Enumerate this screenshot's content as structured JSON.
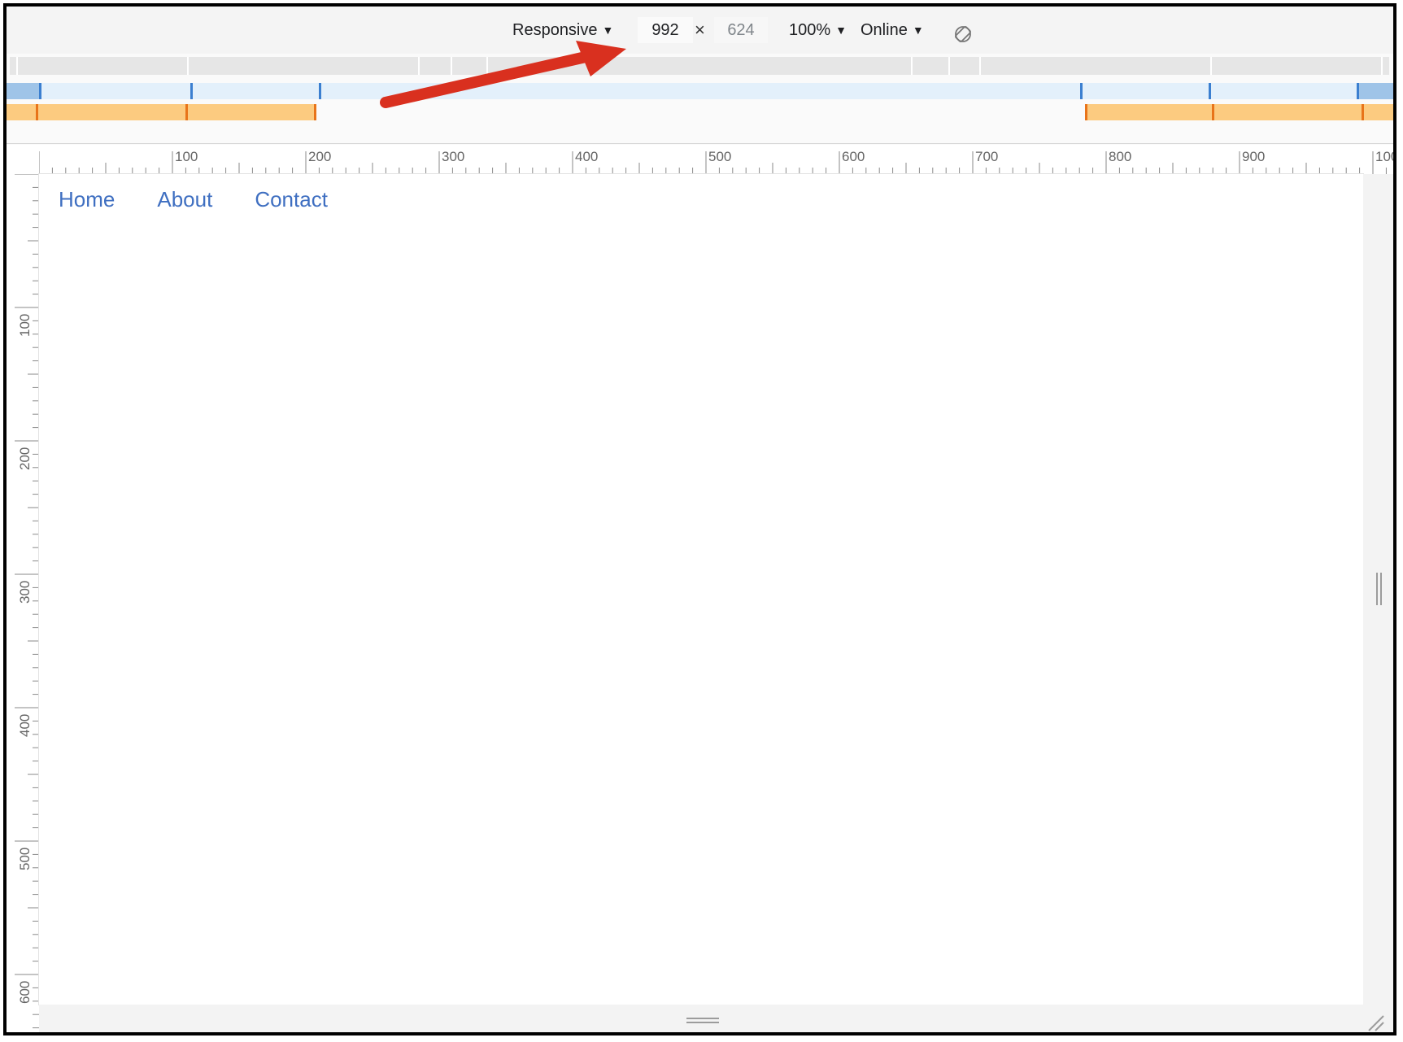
{
  "toolbar": {
    "device_label": "Responsive",
    "width_value": "992",
    "times_symbol": "×",
    "height_value": "624",
    "zoom_label": "100%",
    "network_label": "Online",
    "caret": "▼"
  },
  "ruler": {
    "h_labels": [
      "100",
      "200",
      "300",
      "400",
      "500",
      "600",
      "700",
      "800",
      "900",
      "100"
    ],
    "v_labels": [
      "100",
      "200",
      "300",
      "400",
      "500",
      "600"
    ]
  },
  "nav": {
    "items": [
      "Home",
      "About",
      "Contact"
    ]
  },
  "colors": {
    "mq_blue_light": "#e3f0fb",
    "mq_blue": "#9fc4e8",
    "mq_blue_tick": "#3b7fd0",
    "mq_orange": "#fccb80",
    "mq_orange_tick": "#e8741a",
    "arrow": "#d9301f",
    "link": "#3f6fc1"
  }
}
